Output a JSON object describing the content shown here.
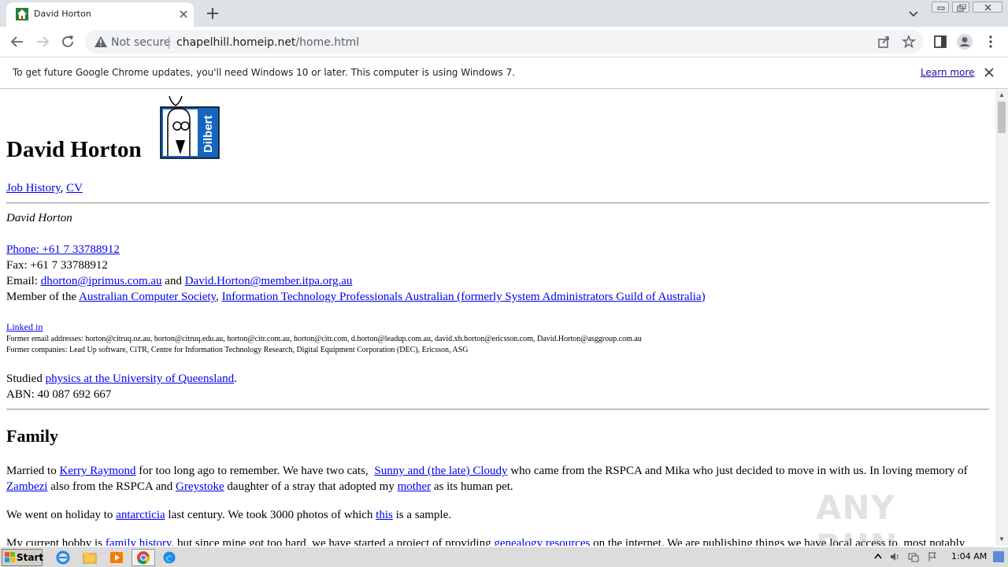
{
  "browser": {
    "tab_title": "David Horton",
    "url_domain": "chapelhill.homeip.net",
    "url_path": "/home.html",
    "security_label": "Not secure"
  },
  "infobar": {
    "message": "To get future Google Chrome updates, you'll need Windows 10 or later. This computer is using Windows 7.",
    "link": "Learn more"
  },
  "page": {
    "title": "David Horton",
    "top_links": {
      "job_history": "Job History",
      "sep": ",",
      "cv": "CV"
    },
    "name_italic": "David Horton",
    "phone": "Phone: +61 7 33788912",
    "fax": "Fax: +61 7 33788912",
    "email_label": "Email:",
    "email1": "dhorton@iprimus.com.au",
    "email_and": "and",
    "email2": "David.Horton@member.itpa.org.au",
    "member_label": "Member of the",
    "member_acs": "Australian Computer Society",
    "member_sep": ",",
    "member_itpa": "Information Technology Professionals Australian (formerly System Administrators Guild of Australia)",
    "linkedin": "Linked in",
    "former_emails": "Former email addresses: horton@citruq.oz.au, horton@citruq.edu.au, horton@citr.com.au, horton@citr.com, d.horton@leadup.com.au, david.xh.horton@ericsson.com, David.Horton@asggroup.com.au",
    "former_companies": "Former companies: Lead Up software, CiTR, Centre for Information Technology Research, Digital Equipment Corporation (DEC), Ericsson, ASG",
    "studied_label": "Studied",
    "studied_link": "physics at the University of Queensland",
    "studied_end": ".",
    "abn": "ABN: 40 087 692 667",
    "family_heading": "Family",
    "fam_p1_a": "Married to",
    "fam_kerry": "Kerry Raymond",
    "fam_p1_b": "for too long ago to remember. We have two cats,",
    "fam_cats": "Sunny and (the late) Cloudy",
    "fam_p1_c": "who came from the RSPCA and Mika who just decided to move in with us. In loving memory of",
    "fam_zambezi": "Zambezi",
    "fam_p1_d": "also from the RSPCA and",
    "fam_greystoke": "Greystoke",
    "fam_p1_e": "daughter of a stray that adopted my",
    "fam_mother": "mother",
    "fam_p1_f": "as its human pet.",
    "holiday_a": "We went on holiday to",
    "holiday_link": "antarcticia",
    "holiday_b": "last century. We took 3000 photos of which",
    "holiday_this": "this",
    "holiday_c": "is a sample.",
    "hobby_a": "My current hobby is",
    "hobby_link1": "family history",
    "hobby_b": ", but since mine got too hard, we have started a project of providing",
    "hobby_link2": "genealogy resources",
    "hobby_c": "on the internet. We are publishing things we have local access to, most notably"
  },
  "watermark": "ANY RUN",
  "taskbar": {
    "start_label": "Start",
    "time": "1:04 AM"
  },
  "colors": {
    "link": "#0000ee",
    "tabstrip": "#dee1e6",
    "omnibox": "#f1f3f4"
  }
}
